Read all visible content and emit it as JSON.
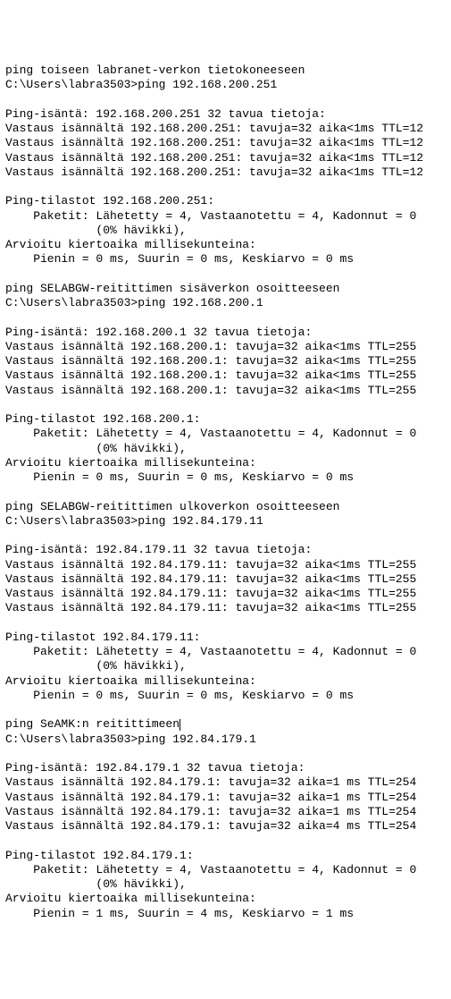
{
  "blocks": [
    {
      "title": "ping toiseen labranet-verkon tietokoneeseen",
      "cmdline": "C:\\Users\\labra3503>ping 192.168.200.251",
      "cursor_after_title": false,
      "header": "Ping-isäntä: 192.168.200.251 32 tavua tietoja:",
      "replies": [
        "Vastaus isännältä 192.168.200.251: tavuja=32 aika<1ms TTL=12",
        "Vastaus isännältä 192.168.200.251: tavuja=32 aika<1ms TTL=12",
        "Vastaus isännältä 192.168.200.251: tavuja=32 aika<1ms TTL=12",
        "Vastaus isännältä 192.168.200.251: tavuja=32 aika<1ms TTL=12"
      ],
      "stats_header": "Ping-tilastot 192.168.200.251:",
      "packets": "    Paketit: Lähetetty = 4, Vastaanotettu = 4, Kadonnut = 0",
      "loss": "             (0% hävikki),",
      "rtt_header": "Arvioitu kiertoaika millisekunteina:",
      "rtt": "    Pienin = 0 ms, Suurin = 0 ms, Keskiarvo = 0 ms"
    },
    {
      "title": "ping SELABGW-reitittimen sisäverkon osoitteeseen",
      "cmdline": "C:\\Users\\labra3503>ping 192.168.200.1",
      "cursor_after_title": false,
      "header": "Ping-isäntä: 192.168.200.1 32 tavua tietoja:",
      "replies": [
        "Vastaus isännältä 192.168.200.1: tavuja=32 aika<1ms TTL=255",
        "Vastaus isännältä 192.168.200.1: tavuja=32 aika<1ms TTL=255",
        "Vastaus isännältä 192.168.200.1: tavuja=32 aika<1ms TTL=255",
        "Vastaus isännältä 192.168.200.1: tavuja=32 aika<1ms TTL=255"
      ],
      "stats_header": "Ping-tilastot 192.168.200.1:",
      "packets": "    Paketit: Lähetetty = 4, Vastaanotettu = 4, Kadonnut = 0",
      "loss": "             (0% hävikki),",
      "rtt_header": "Arvioitu kiertoaika millisekunteina:",
      "rtt": "    Pienin = 0 ms, Suurin = 0 ms, Keskiarvo = 0 ms"
    },
    {
      "title": "ping SELABGW-reitittimen ulkoverkon osoitteeseen",
      "cmdline": "C:\\Users\\labra3503>ping 192.84.179.11",
      "cursor_after_title": false,
      "header": "Ping-isäntä: 192.84.179.11 32 tavua tietoja:",
      "replies": [
        "Vastaus isännältä 192.84.179.11: tavuja=32 aika<1ms TTL=255",
        "Vastaus isännältä 192.84.179.11: tavuja=32 aika<1ms TTL=255",
        "Vastaus isännältä 192.84.179.11: tavuja=32 aika<1ms TTL=255",
        "Vastaus isännältä 192.84.179.11: tavuja=32 aika<1ms TTL=255"
      ],
      "stats_header": "Ping-tilastot 192.84.179.11:",
      "packets": "    Paketit: Lähetetty = 4, Vastaanotettu = 4, Kadonnut = 0",
      "loss": "             (0% hävikki),",
      "rtt_header": "Arvioitu kiertoaika millisekunteina:",
      "rtt": "    Pienin = 0 ms, Suurin = 0 ms, Keskiarvo = 0 ms"
    },
    {
      "title": "ping SeAMK:n reitittimeen",
      "cmdline": "C:\\Users\\labra3503>ping 192.84.179.1",
      "cursor_after_title": true,
      "header": "Ping-isäntä: 192.84.179.1 32 tavua tietoja:",
      "replies": [
        "Vastaus isännältä 192.84.179.1: tavuja=32 aika=1 ms TTL=254",
        "Vastaus isännältä 192.84.179.1: tavuja=32 aika=1 ms TTL=254",
        "Vastaus isännältä 192.84.179.1: tavuja=32 aika=1 ms TTL=254",
        "Vastaus isännältä 192.84.179.1: tavuja=32 aika=4 ms TTL=254"
      ],
      "stats_header": "Ping-tilastot 192.84.179.1:",
      "packets": "    Paketit: Lähetetty = 4, Vastaanotettu = 4, Kadonnut = 0",
      "loss": "             (0% hävikki),",
      "rtt_header": "Arvioitu kiertoaika millisekunteina:",
      "rtt": "    Pienin = 1 ms, Suurin = 4 ms, Keskiarvo = 1 ms"
    }
  ]
}
